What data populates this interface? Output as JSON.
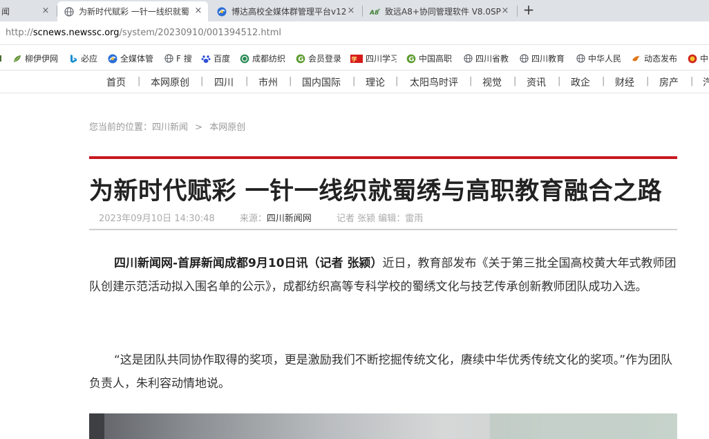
{
  "browser": {
    "tabs": [
      {
        "label": "闻",
        "icon": "none",
        "active": false
      },
      {
        "label": "为新时代赋彩 一针一线织就蜀",
        "icon": "globe-icon",
        "active": true
      },
      {
        "label": "博达高校全媒体群管理平台v12",
        "icon": "chrome-app-icon",
        "active": false
      },
      {
        "label": "致远A8+协同管理软件 V8.0SP",
        "icon": "a8-icon",
        "active": false
      }
    ],
    "close_glyph": "×",
    "new_tab_glyph": "+",
    "address": {
      "scheme": "http://",
      "host": "scnews.newssc.org",
      "path": "/system/20230910/001394512.html"
    }
  },
  "bookmarks": [
    {
      "label": "柳伊伊网",
      "icon": "leaf-icon"
    },
    {
      "label": "必应",
      "icon": "bing-icon"
    },
    {
      "label": "全媒体管",
      "icon": "chrome-app-icon"
    },
    {
      "label": "F 搜",
      "icon": "globe-icon"
    },
    {
      "label": "百度",
      "icon": "baidu-paw-icon"
    },
    {
      "label": "成都纺织",
      "icon": "college-logo-icon"
    },
    {
      "label": "会员登录",
      "icon": "g-logo-icon"
    },
    {
      "label": "四川学习",
      "icon": "study-logo-icon"
    },
    {
      "label": "中国高职",
      "icon": "g-logo-icon"
    },
    {
      "label": "四川省教",
      "icon": "globe-icon"
    },
    {
      "label": "四川教育",
      "icon": "globe-icon"
    },
    {
      "label": "中华人民",
      "icon": "globe-icon"
    },
    {
      "label": "动态发布",
      "icon": "bird-logo-icon"
    },
    {
      "label": "中",
      "icon": "emblem-icon"
    }
  ],
  "site_nav": [
    "首页",
    "本网原创",
    "四川",
    "市州",
    "国内国际",
    "理论",
    "太阳鸟时评",
    "视觉",
    "资讯",
    "政企",
    "财经",
    "房产",
    "汽"
  ],
  "article": {
    "breadcrumb": {
      "prefix": "您当前的位置：",
      "items": [
        "四川新闻",
        "本网原创"
      ],
      "separator": ">"
    },
    "title": "为新时代赋彩 一针一线织就蜀绣与高职教育融合之路",
    "meta": {
      "datetime": "2023年09月10日 14:30:48",
      "source_label": "来源：",
      "source_value": "四川新闻网",
      "reporter": "记者 张颍 编辑：雷雨"
    },
    "para1_lead": "四川新闻网-首屏新闻成都9月10日讯（记者 张颍）",
    "para1_body": "近日，教育部发布《关于第三批全国高校黄大年式教师团队创建示范活动拟入围名单的公示》，成都纺织高等专科学校的蜀绣文化与技艺传承创新教师团队成功入选。",
    "para2": "“这是团队共同协作取得的奖项，更是激励我们不断挖掘传统文化，赓续中华优秀传统文化的奖项。”作为团队负责人，朱利容动情地说。"
  },
  "colors": {
    "accent_red": "#c6181f",
    "tab_strip": "#dee1e6"
  }
}
